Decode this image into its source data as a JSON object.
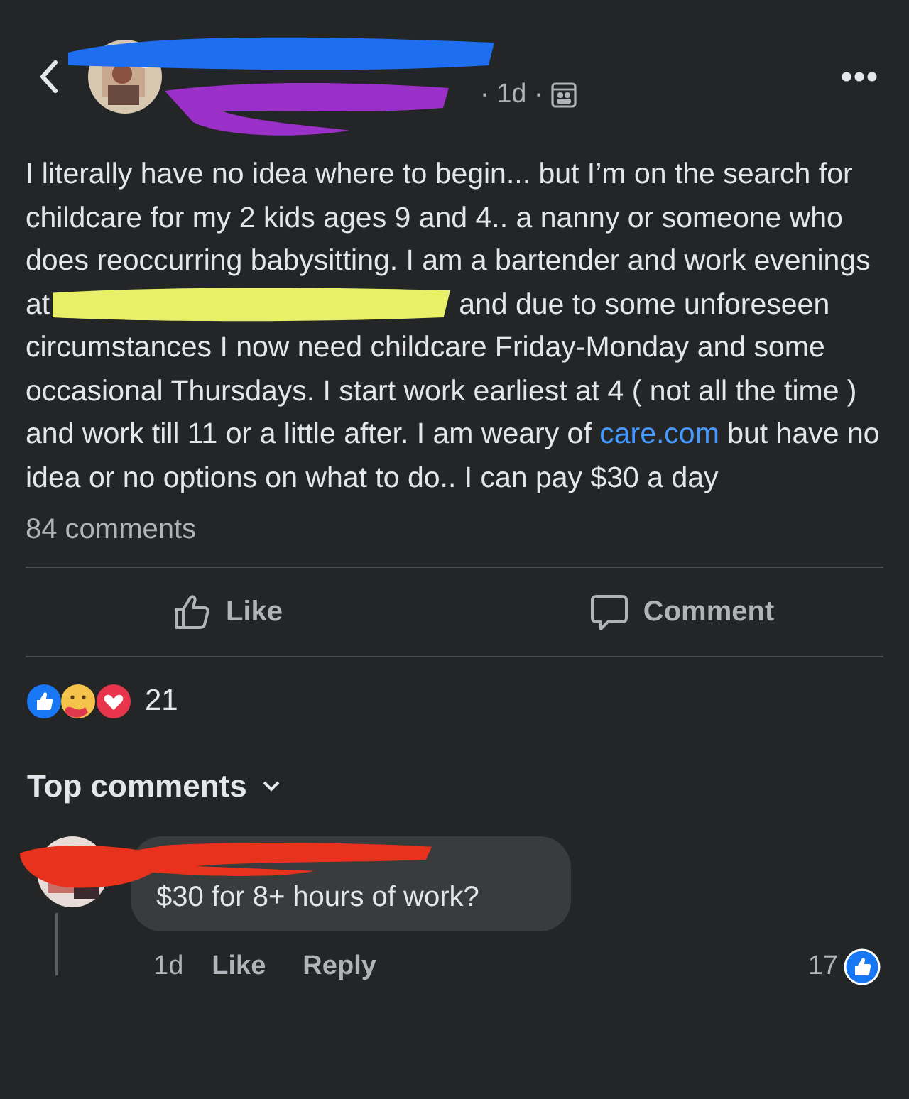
{
  "header": {
    "meta": "· 1d ·",
    "name_redaction": {
      "color": "#1f6ef0"
    },
    "meta_redaction": {
      "color": "#9a30c8"
    }
  },
  "post": {
    "body": [
      {
        "kind": "text",
        "text": "I literally have no idea where to begin... but I’m on the search for childcare for my 2 kids ages 9 and 4.. a nanny or someone who does reoccurring babysitting. I am a bartender and work evenings at"
      },
      {
        "kind": "redaction",
        "color": "#e8f06a"
      },
      {
        "kind": "text",
        "text": "and due to some unforeseen circumstances I now need childcare Friday-Monday and some occasional Thursdays. I start work earliest at 4 ( not all the time ) and work till 11 or a little after. I am weary of "
      },
      {
        "kind": "link",
        "text": "care.com"
      },
      {
        "kind": "text",
        "text": " but have no idea or no options on what to do.. I can pay $30 a day"
      }
    ],
    "comment_count": "84 comments"
  },
  "actions": [
    {
      "kind": "like",
      "label": "Like"
    },
    {
      "kind": "comment",
      "label": "Comment"
    }
  ],
  "reactions": {
    "count": "21"
  },
  "comments_heading": "Top comments",
  "comments": [
    {
      "author_redaction": {
        "color": "#e8321e"
      },
      "text": "$30 for 8+ hours of work?",
      "time": "1d",
      "like": "Like",
      "reply": "Reply",
      "likes": "17"
    }
  ]
}
